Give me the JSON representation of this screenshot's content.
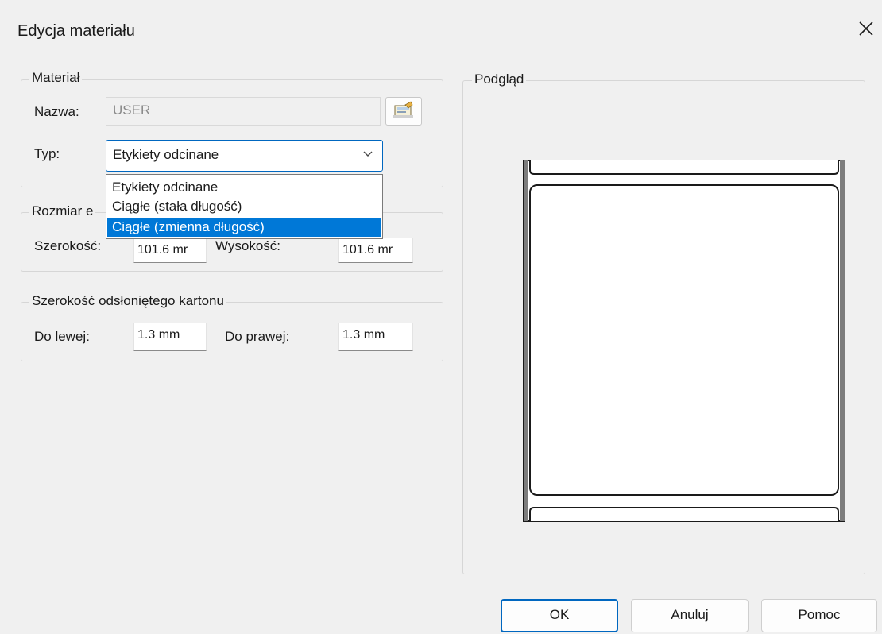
{
  "window": {
    "title": "Edycja materiału"
  },
  "material_group": {
    "legend": "Materiał",
    "name_label": "Nazwa:",
    "name_value": "USER",
    "type_label": "Typ:",
    "type_selected": "Etykiety odcinane",
    "type_options": [
      "Etykiety odcinane",
      "Ciągłe (stała długość)",
      "Ciągłe (zmienna długość)"
    ],
    "type_highlighted": "Ciągłe (zmienna długość)"
  },
  "size_group": {
    "legend": "Rozmiar e",
    "width_label": "Szerokość:",
    "width_value": "101.6 mr",
    "height_label": "Wysokość:",
    "height_value": "101.6 mr"
  },
  "liner_group": {
    "legend": "Szerokość odsłoniętego kartonu",
    "left_label": "Do lewej:",
    "left_value": "1.3 mm",
    "right_label": "Do prawej:",
    "right_value": "1.3 mm"
  },
  "preview_group": {
    "legend": "Podgląd"
  },
  "buttons": {
    "ok": "OK",
    "cancel": "Anuluj",
    "help": "Pomoc"
  },
  "colors": {
    "accent": "#0067c0",
    "selection": "#0078d7",
    "background": "#f0f0f0"
  },
  "icons": {
    "close": "close-icon",
    "browse": "browse-materials-icon",
    "chevron": "chevron-down-icon"
  }
}
